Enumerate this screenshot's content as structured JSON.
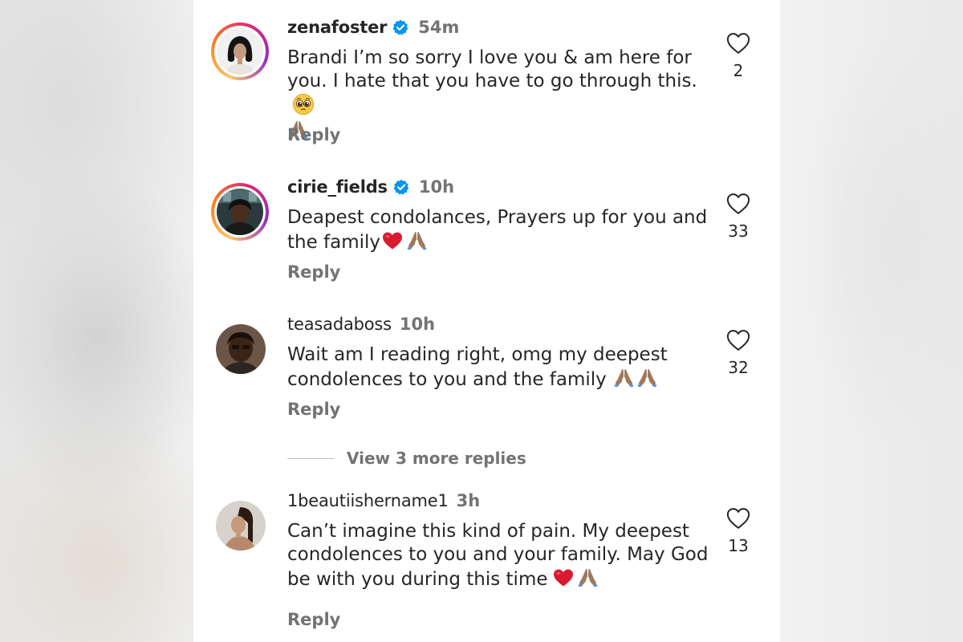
{
  "comments": [
    {
      "username": "zenafoster",
      "verified": true,
      "time": "54m",
      "text_l1": "Brandi I’m so sorry I love you & am here for",
      "text_l2": "you. I hate that you have to go through this.",
      "reply_label": "Reply",
      "likes": "2",
      "icons": [
        "verified-badge-icon",
        "heart-outline-icon",
        "pleading-face-emoji",
        "folded-hands-emoji"
      ]
    },
    {
      "username": "cirie_fields",
      "verified": true,
      "time": "10h",
      "text_l1": "Deapest condolances, Prayers up for you and",
      "text_l2": "the family",
      "reply_label": "Reply",
      "likes": "33",
      "icons": [
        "verified-badge-icon",
        "heart-outline-icon",
        "red-heart-emoji",
        "folded-hands-emoji"
      ]
    },
    {
      "username": "teasadaboss",
      "verified": false,
      "time": "10h",
      "text_l1": "Wait am I reading right, omg my deepest",
      "text_l2": "condolences to you and the family",
      "reply_label": "Reply",
      "likes": "32",
      "view_more_replies": "View 3 more replies",
      "icons": [
        "heart-outline-icon",
        "folded-hands-emoji"
      ]
    },
    {
      "username": "1beautiishername1",
      "verified": false,
      "time": "3h",
      "text_l1": "Can’t imagine this kind of pain. My deepest",
      "text_l2": "condolences to you and your family. May God",
      "text_l3": "be with you during this time",
      "reply_label": "Reply",
      "likes": "13",
      "icons": [
        "heart-outline-icon",
        "red-heart-emoji",
        "folded-hands-emoji"
      ]
    }
  ],
  "colors": {
    "text": "#262626",
    "secondary": "#737373",
    "verified_blue": "#0095f6",
    "story_ring": [
      "#fdc468",
      "#fa7e1e",
      "#d62976",
      "#962fbf"
    ]
  }
}
